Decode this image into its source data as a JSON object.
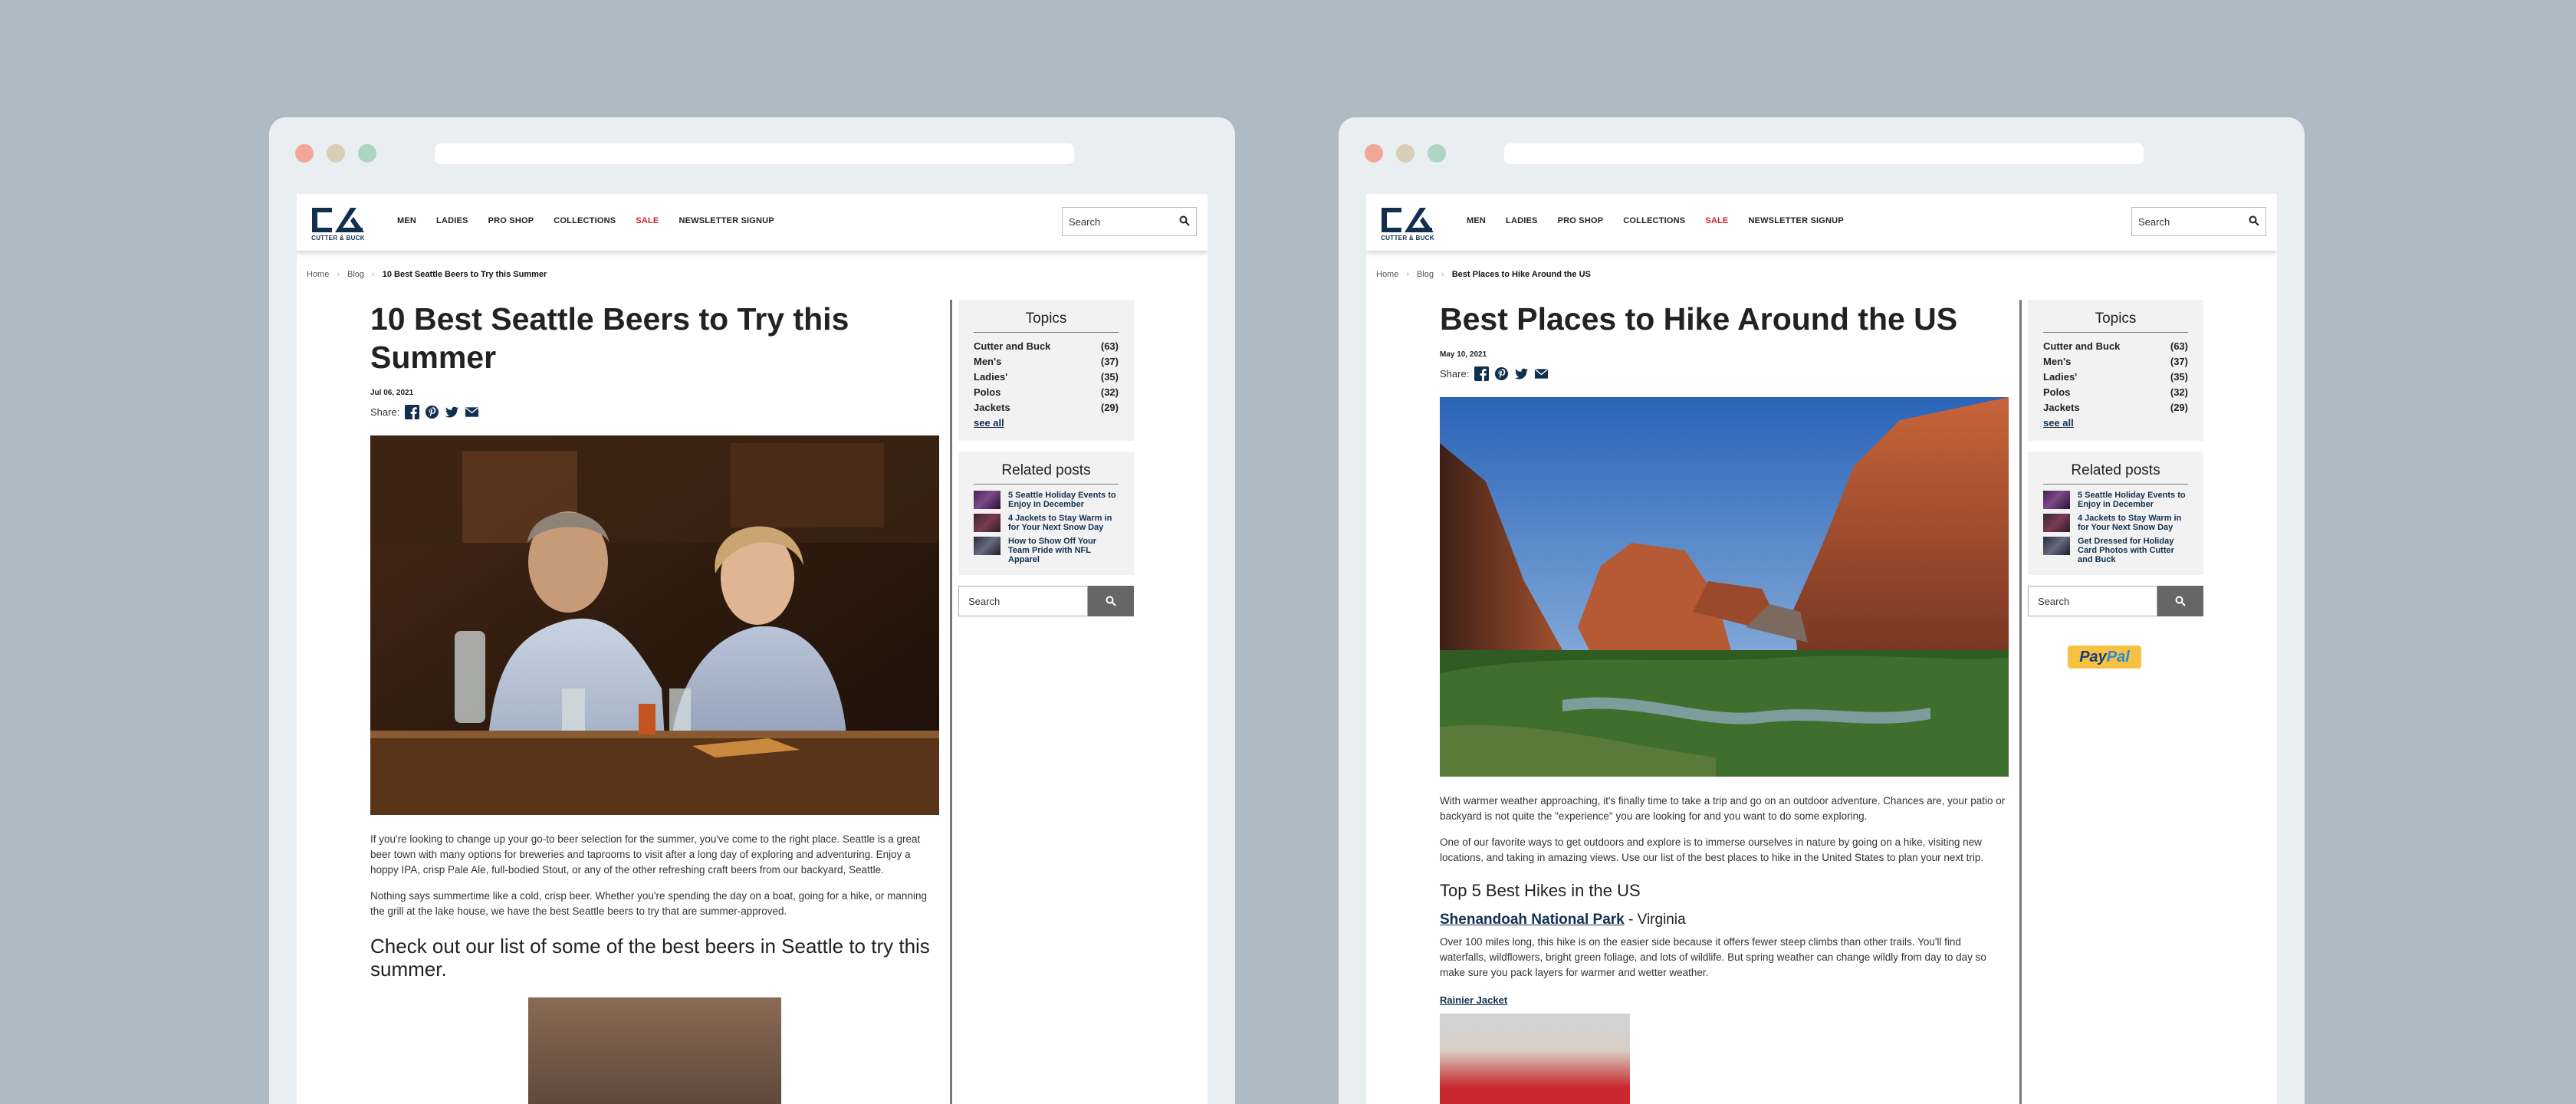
{
  "site": {
    "logo_text": "CUTTER & BUCK",
    "nav": [
      "MEN",
      "LADIES",
      "PRO SHOP",
      "COLLECTIONS",
      "SALE",
      "NEWSLETTER SIGNUP"
    ],
    "search_placeholder": "Search",
    "sale_color": "#d0202f",
    "brand_color": "#12304e"
  },
  "sidebar": {
    "topics_title": "Topics",
    "topics": [
      {
        "name": "Cutter and Buck",
        "count": "(63)"
      },
      {
        "name": "Men's",
        "count": "(37)"
      },
      {
        "name": "Ladies'",
        "count": "(35)"
      },
      {
        "name": "Polos",
        "count": "(32)"
      },
      {
        "name": "Jackets",
        "count": "(29)"
      }
    ],
    "see_all": "see all",
    "related_title": "Related posts",
    "related_left": [
      "5 Seattle Holiday Events to Enjoy in December",
      "4 Jackets to Stay Warm in for Your Next Snow Day",
      "How to Show Off Your Team Pride with NFL Apparel"
    ],
    "related_right": [
      "5 Seattle Holiday Events to Enjoy in December",
      "4 Jackets to Stay Warm in for Your Next Snow Day",
      "Get Dressed for Holiday Card Photos with Cutter and Buck"
    ],
    "search_placeholder": "Search"
  },
  "left": {
    "breadcrumb": [
      "Home",
      "Blog",
      "10 Best Seattle Beers to Try this Summer"
    ],
    "title": "10 Best Seattle Beers to Try this Summer",
    "date": "Jul 06, 2021",
    "share_label": "Share:",
    "para1": "If you're looking to change up your go-to beer selection for the summer, you've come to the right place. Seattle is a great beer town with many options for breweries and taprooms to visit after a long day of exploring and adventuring. Enjoy a hoppy IPA, crisp Pale Ale, full-bodied Stout, or any of the other refreshing craft beers from our backyard, Seattle.",
    "para2": "Nothing says summertime like a cold, crisp beer. Whether you're spending the day on a boat, going for a hike, or manning the grill at the lake house, we have the best Seattle beers to try that are summer-approved.",
    "heading": "Check out our list of some of the best beers in Seattle to try this summer."
  },
  "right": {
    "breadcrumb": [
      "Home",
      "Blog",
      "Best Places to Hike Around the US"
    ],
    "title": "Best Places to Hike Around the US",
    "date": "May 10, 2021",
    "share_label": "Share:",
    "para1": "With warmer weather approaching, it's finally time to take a trip and go on an outdoor adventure. Chances are, your patio or backyard is not quite the \"experience\" you are looking for and you want to do some exploring.",
    "para2": "One of our favorite ways to get outdoors and explore is to immerse ourselves in nature by going on a hike, visiting new locations, and taking in amazing views. Use our list of the best places to hike in the United States to plan your next trip.",
    "heading": "Top 5 Best Hikes in the US",
    "park_name": "Shenandoah National Park",
    "park_state": " - Virginia",
    "para3": "Over 100 miles long, this hike is on the easier side because it offers fewer steep climbs than other trails. You'll find waterfalls, wildflowers, bright green foliage, and lots of wildlife. But spring weather can change wildly from day to day so make sure you pack layers for warmer and wetter weather.",
    "product_link": "Rainier Jacket",
    "paypal_pay": "Pay",
    "paypal_pal": "Pal"
  }
}
